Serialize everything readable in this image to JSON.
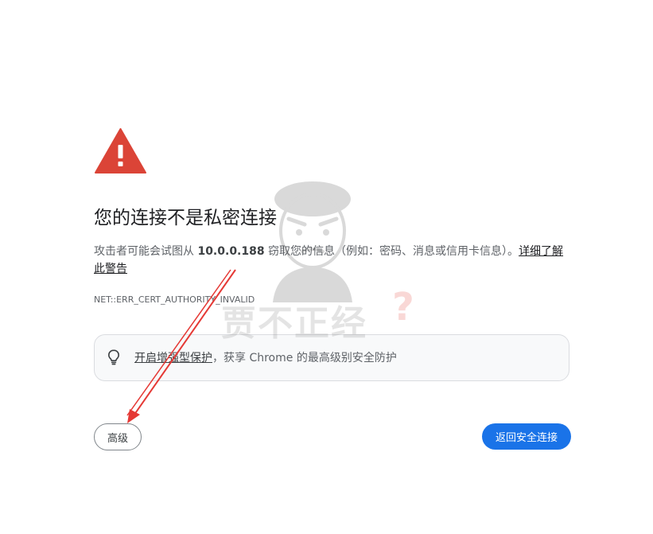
{
  "page": {
    "title": "您的连接不是私密连接",
    "body_prefix": "攻击者可能会试图从 ",
    "host": "10.0.0.188",
    "body_middle": " 窃取您的信息（例如：密码、消息或信用卡信息）。",
    "learn_more_link": "详细了解此警告",
    "error_code": "NET::ERR_CERT_AUTHORITY_INVALID"
  },
  "protection": {
    "link_text": "开启增强型保护",
    "rest_text": "，获享 Chrome 的最高级别安全防护"
  },
  "buttons": {
    "advanced_label": "高级",
    "back_label": "返回安全连接"
  },
  "watermark": {
    "text": "贾不正经",
    "mark": "?"
  },
  "colors": {
    "warning": "#db4437",
    "primary": "#1a73e8",
    "annotation_arrow": "#e53935"
  },
  "icons": {
    "warning": "warning-triangle-icon",
    "bulb": "lightbulb-icon"
  }
}
